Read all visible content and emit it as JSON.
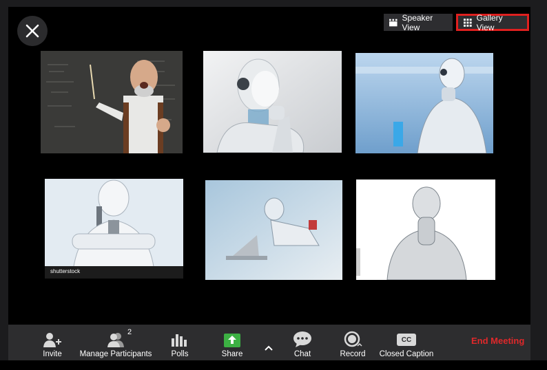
{
  "view_switch": {
    "speaker_label": "Speaker View",
    "gallery_label": "Gallery View"
  },
  "participants": [
    {
      "description": "teacher"
    },
    {
      "description": "robot"
    },
    {
      "description": "robot"
    },
    {
      "description": "robot"
    },
    {
      "description": "robot"
    },
    {
      "description": "robot"
    }
  ],
  "toolbar": {
    "invite": "Invite",
    "manage_participants": "Manage Participants",
    "participants_count": "2",
    "polls": "Polls",
    "share": "Share",
    "chat": "Chat",
    "record": "Record",
    "closed_caption": "Closed Caption",
    "cc_glyph": "CC",
    "end_meeting": "End Meeting"
  },
  "watermark": "shutterstock",
  "colors": {
    "accent_red": "#e0201f",
    "share_green": "#3cb043",
    "toolbar_bg": "#2d2d2f"
  }
}
